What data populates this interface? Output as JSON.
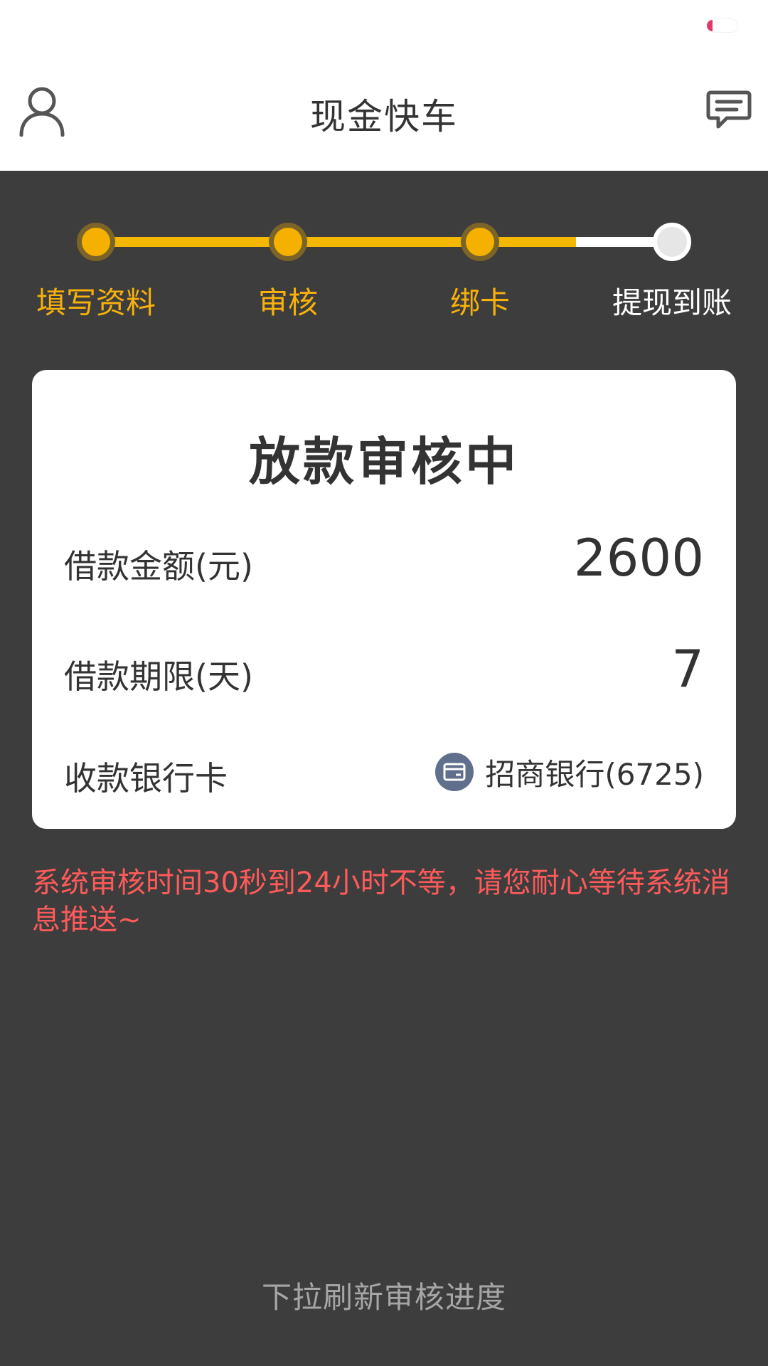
{
  "app": {
    "title": "现金快车"
  },
  "header": {
    "left_icon": "user-profile-icon",
    "right_icon": "message-icon"
  },
  "steps": [
    {
      "label": "填写资料",
      "state": "done"
    },
    {
      "label": "审核",
      "state": "done"
    },
    {
      "label": "绑卡",
      "state": "done"
    },
    {
      "label": "提现到账",
      "state": "todo"
    }
  ],
  "colors": {
    "accent": "#f5b800",
    "background": "#3d3d3d",
    "notice": "#ff5a5a"
  },
  "card": {
    "title": "放款审核中",
    "amount_label": "借款金额(元)",
    "amount_value": "2600",
    "term_label": "借款期限(天)",
    "term_value": "7",
    "bank_label": "收款银行卡",
    "bank_value": "招商银行(6725)",
    "bank_icon": "bank-card-icon"
  },
  "notice": "系统审核时间30秒到24小时不等，请您耐心等待系统消息推送~",
  "footer": {
    "pull_hint": "下拉刷新审核进度"
  }
}
